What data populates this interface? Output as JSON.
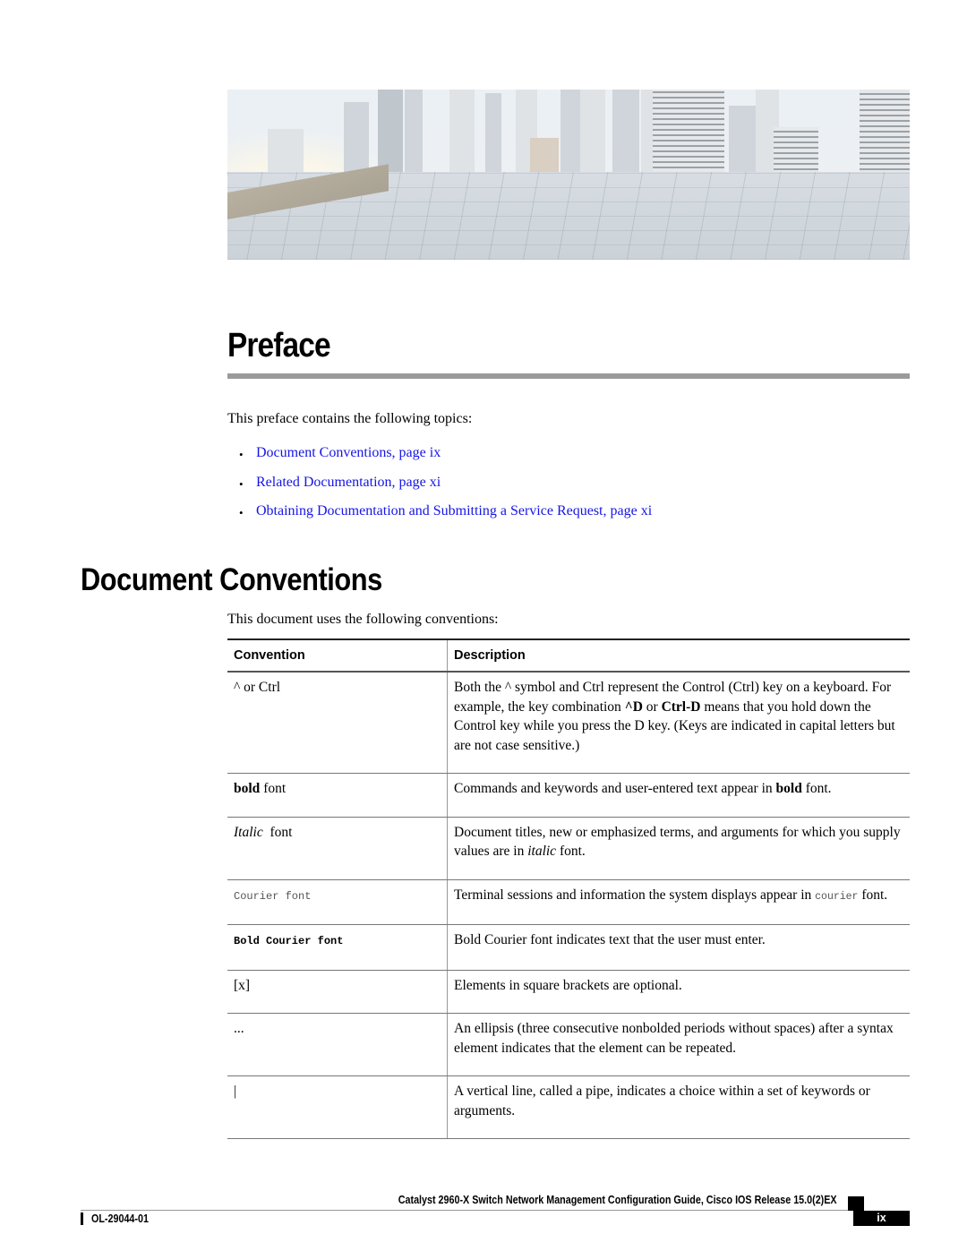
{
  "hero_image": {
    "description": "city skyline viewed from a rooftop deck with solar panels"
  },
  "page_title": "Preface",
  "intro_text": "This preface contains the following topics:",
  "topics": [
    {
      "label": "Document Conventions,  page  ix"
    },
    {
      "label": "Related Documentation,  page  xi"
    },
    {
      "label": "Obtaining Documentation and Submitting a Service Request,  page  xi"
    }
  ],
  "link_color": "#1515e6",
  "section": {
    "title": "Document Conventions",
    "intro": "This document uses the following conventions:",
    "table": {
      "headers": {
        "convention": "Convention",
        "description": "Description"
      },
      "rows": [
        {
          "convention": "^ or Ctrl",
          "description": {
            "t1": "Both the ^ symbol and Ctrl represent the Control (Ctrl) key on a keyboard. For example, the key combination ",
            "b1": "^D",
            "t2": " or ",
            "b2": "Ctrl-D",
            "t3": " means that you hold down the Control key while you press the D key. (Keys are indicated in capital letters but are not case sensitive.)"
          }
        },
        {
          "convention": {
            "emph": "bold",
            "rest": " font"
          },
          "description": {
            "t1": "Commands and keywords and user-entered text appear in ",
            "b1": "bold",
            "t2": " font."
          }
        },
        {
          "convention": {
            "emph": "Italic",
            "rest": "  font"
          },
          "description": {
            "t1": "Document titles, new or emphasized terms, and arguments for which you supply values are in ",
            "i1": "italic",
            "t2": " font."
          }
        },
        {
          "convention": "Courier font",
          "description": {
            "t1": "Terminal sessions and information the system displays appear in ",
            "m1": "courier",
            "t2": " font."
          }
        },
        {
          "convention": "Bold Courier font",
          "description": "Bold Courier font indicates text that the user must enter."
        },
        {
          "convention": "[x]",
          "description": "Elements in square brackets are optional."
        },
        {
          "convention": "...",
          "description": "An ellipsis (three consecutive nonbolded periods without spaces) after a syntax element indicates that the element can be repeated."
        },
        {
          "convention": "|",
          "description": "A vertical line, called a pipe, indicates a choice within a set of keywords or arguments."
        }
      ]
    }
  },
  "footer": {
    "guide_title": "Catalyst 2960-X Switch Network Management Configuration Guide, Cisco IOS Release 15.0(2)EX",
    "doc_number": "OL-29044-01",
    "page_number": "ix"
  }
}
